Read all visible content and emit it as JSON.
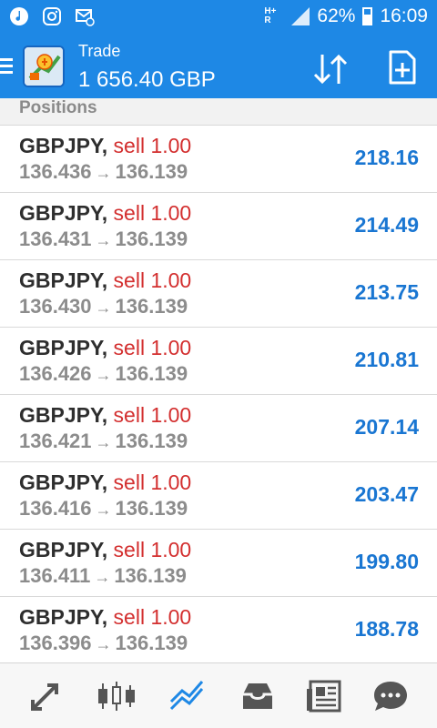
{
  "status_bar": {
    "battery": "62%",
    "time": "16:09",
    "network": "H+ R"
  },
  "app_bar": {
    "title": "Trade",
    "balance": "1 656.40 GBP"
  },
  "section": {
    "title": "Positions"
  },
  "positions": [
    {
      "symbol": "GBPJPY,",
      "action": "sell 1.00",
      "open": "136.436",
      "current": "136.139",
      "profit": "218.16"
    },
    {
      "symbol": "GBPJPY,",
      "action": "sell 1.00",
      "open": "136.431",
      "current": "136.139",
      "profit": "214.49"
    },
    {
      "symbol": "GBPJPY,",
      "action": "sell 1.00",
      "open": "136.430",
      "current": "136.139",
      "profit": "213.75"
    },
    {
      "symbol": "GBPJPY,",
      "action": "sell 1.00",
      "open": "136.426",
      "current": "136.139",
      "profit": "210.81"
    },
    {
      "symbol": "GBPJPY,",
      "action": "sell 1.00",
      "open": "136.421",
      "current": "136.139",
      "profit": "207.14"
    },
    {
      "symbol": "GBPJPY,",
      "action": "sell 1.00",
      "open": "136.416",
      "current": "136.139",
      "profit": "203.47"
    },
    {
      "symbol": "GBPJPY,",
      "action": "sell 1.00",
      "open": "136.411",
      "current": "136.139",
      "profit": "199.80"
    },
    {
      "symbol": "GBPJPY,",
      "action": "sell 1.00",
      "open": "136.396",
      "current": "136.139",
      "profit": "188.78"
    }
  ],
  "bottom_nav": [
    {
      "icon": "quotes-icon",
      "active": false
    },
    {
      "icon": "chart-icon",
      "active": false
    },
    {
      "icon": "trade-icon",
      "active": true
    },
    {
      "icon": "history-icon",
      "active": false
    },
    {
      "icon": "news-icon",
      "active": false
    },
    {
      "icon": "chat-icon",
      "active": false
    }
  ],
  "colors": {
    "primary": "#1e88e5",
    "sell": "#d32f2f",
    "profit": "#1976d2",
    "muted": "#8c8c8c",
    "nav_icon": "#555555",
    "nav_active": "#1e88e5"
  }
}
